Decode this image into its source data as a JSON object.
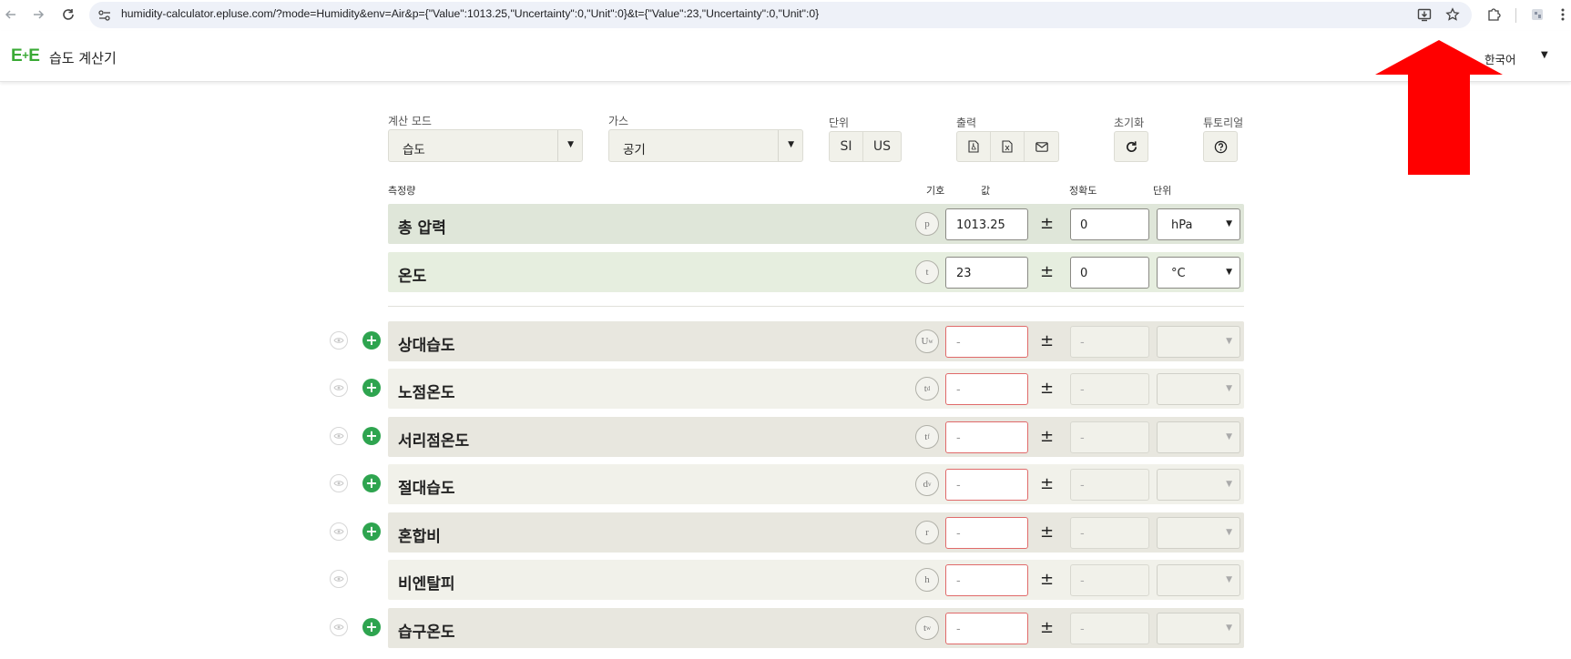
{
  "browser": {
    "url": "humidity-calculator.epluse.com/?mode=Humidity&env=Air&p={\"Value\":1013.25,\"Uncertainty\":0,\"Unit\":0}&t={\"Value\":23,\"Uncertainty\":0,\"Unit\":0}"
  },
  "header": {
    "logo_e1": "E",
    "logo_plus": "+",
    "logo_e2": "E",
    "title": "습도 계산기",
    "language": "한국어"
  },
  "controls": {
    "mode_label": "계산 모드",
    "mode_value": "습도",
    "gas_label": "가스",
    "gas_value": "공기",
    "unit_label": "단위",
    "unit_si": "SI",
    "unit_us": "US",
    "output_label": "출력",
    "reset_label": "초기화",
    "tutorial_label": "튜토리얼"
  },
  "table": {
    "headers": {
      "quantity": "측정량",
      "symbol": "기호",
      "value": "값",
      "accuracy": "정확도",
      "unit": "단위"
    },
    "inputs": [
      {
        "label": "총 압력",
        "symbol": "p",
        "value": "1013.25",
        "uncertainty": "0",
        "unit": "hPa"
      },
      {
        "label": "온도",
        "symbol": "t",
        "value": "23",
        "uncertainty": "0",
        "unit": "°C"
      }
    ],
    "outputs": [
      {
        "label": "상대습도",
        "symbol": "U",
        "sub": "w",
        "value": "-",
        "uncertainty": "-",
        "has_plus": true
      },
      {
        "label": "노점온도",
        "symbol": "t",
        "sub": "d",
        "value": "-",
        "uncertainty": "-",
        "has_plus": true
      },
      {
        "label": "서리점온도",
        "symbol": "t",
        "sub": "f",
        "value": "-",
        "uncertainty": "-",
        "has_plus": true
      },
      {
        "label": "절대습도",
        "symbol": "d",
        "sub": "v",
        "value": "-",
        "uncertainty": "-",
        "has_plus": true
      },
      {
        "label": "혼합비",
        "symbol": "r",
        "sub": "",
        "value": "-",
        "uncertainty": "-",
        "has_plus": true
      },
      {
        "label": "비엔탈피",
        "symbol": "h",
        "sub": "",
        "value": "-",
        "uncertainty": "-",
        "has_plus": false
      },
      {
        "label": "습구온도",
        "symbol": "t",
        "sub": "w",
        "value": "-",
        "uncertainty": "-",
        "has_plus": true
      }
    ]
  },
  "colors": {
    "brand_green": "#3aaa35",
    "plus_green": "#2ea44f",
    "arrow_red": "#ff0000"
  },
  "icons": {
    "back": "arrow-left-icon",
    "forward": "arrow-right-icon",
    "reload": "reload-icon",
    "install": "install-app-icon",
    "bookmark": "star-icon",
    "extensions": "puzzle-icon"
  }
}
